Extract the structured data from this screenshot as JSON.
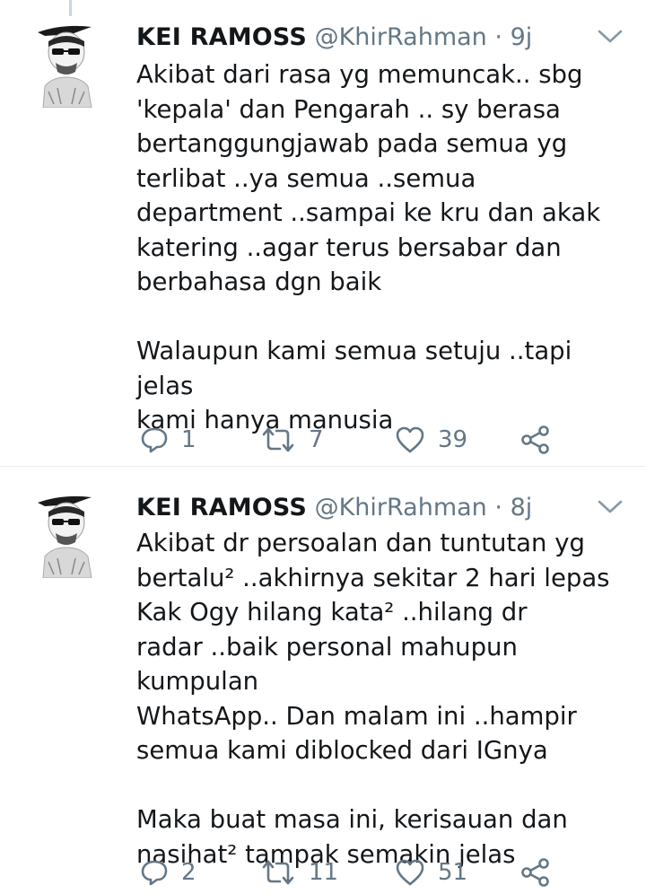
{
  "tweets": [
    {
      "author_name": "KEI RAMOSS",
      "handle": "@KhirRahman",
      "separator": "·",
      "time": "9j",
      "paragraphs": [
        "Akibat dari rasa yg memuncak.. sbg\n'kepala' dan Pengarah .. sy berasa\nbertanggungjawab pada semua yg\nterlibat ..ya semua ..semua\ndepartment ..sampai ke kru dan akak\nkatering ..agar terus bersabar dan\nberbahasa dgn baik",
        "Walaupun kami semua setuju ..tapi jelas\nkami hanya manusia"
      ],
      "replies": "1",
      "retweets": "7",
      "likes": "39"
    },
    {
      "author_name": "KEI RAMOSS",
      "handle": "@KhirRahman",
      "separator": "·",
      "time": "8j",
      "paragraphs": [
        "Akibat dr persoalan dan tuntutan yg\nbertalu² ..akhirnya sekitar 2 hari lepas\nKak Ogy hilang kata² ..hilang dr\nradar ..baik personal mahupun kumpulan\nWhatsApp.. Dan malam ini ..hampir\nsemua kami diblocked dari IGnya",
        "Maka buat masa ini, kerisauan dan\nnasihat² tampak semakin jelas"
      ],
      "replies": "2",
      "retweets": "11",
      "likes": "51"
    }
  ],
  "icons": {
    "reply": "reply-icon",
    "retweet": "retweet-icon",
    "like": "heart-icon",
    "share": "share-icon",
    "menu": "chevron-down-icon"
  },
  "colors": {
    "text": "#14171a",
    "secondary": "#657786",
    "divider": "#e6ecf0",
    "thread_line": "#ccd6dd"
  }
}
